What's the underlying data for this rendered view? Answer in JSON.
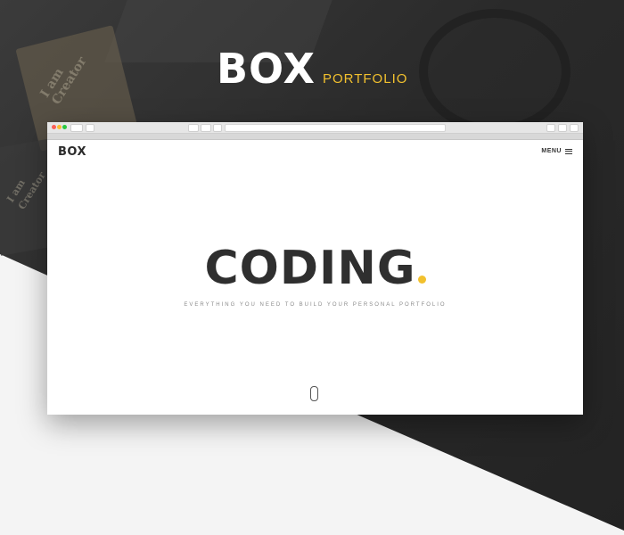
{
  "hero_logo": {
    "word": "BOX",
    "tag": "PORTFOLIO"
  },
  "background_card_text": [
    "I am",
    "Creator",
    "I am",
    "Creator"
  ],
  "site": {
    "logo": "BOX",
    "menu_label": "MENU",
    "hero_title": "CODING",
    "hero_subtitle": "EVERYTHING YOU NEED TO BUILD YOUR PERSONAL PORTFOLIO"
  },
  "colors": {
    "accent": "#f2c12e",
    "dark_bg": "#2a2a2a",
    "text_dark": "#2f2f2f"
  }
}
